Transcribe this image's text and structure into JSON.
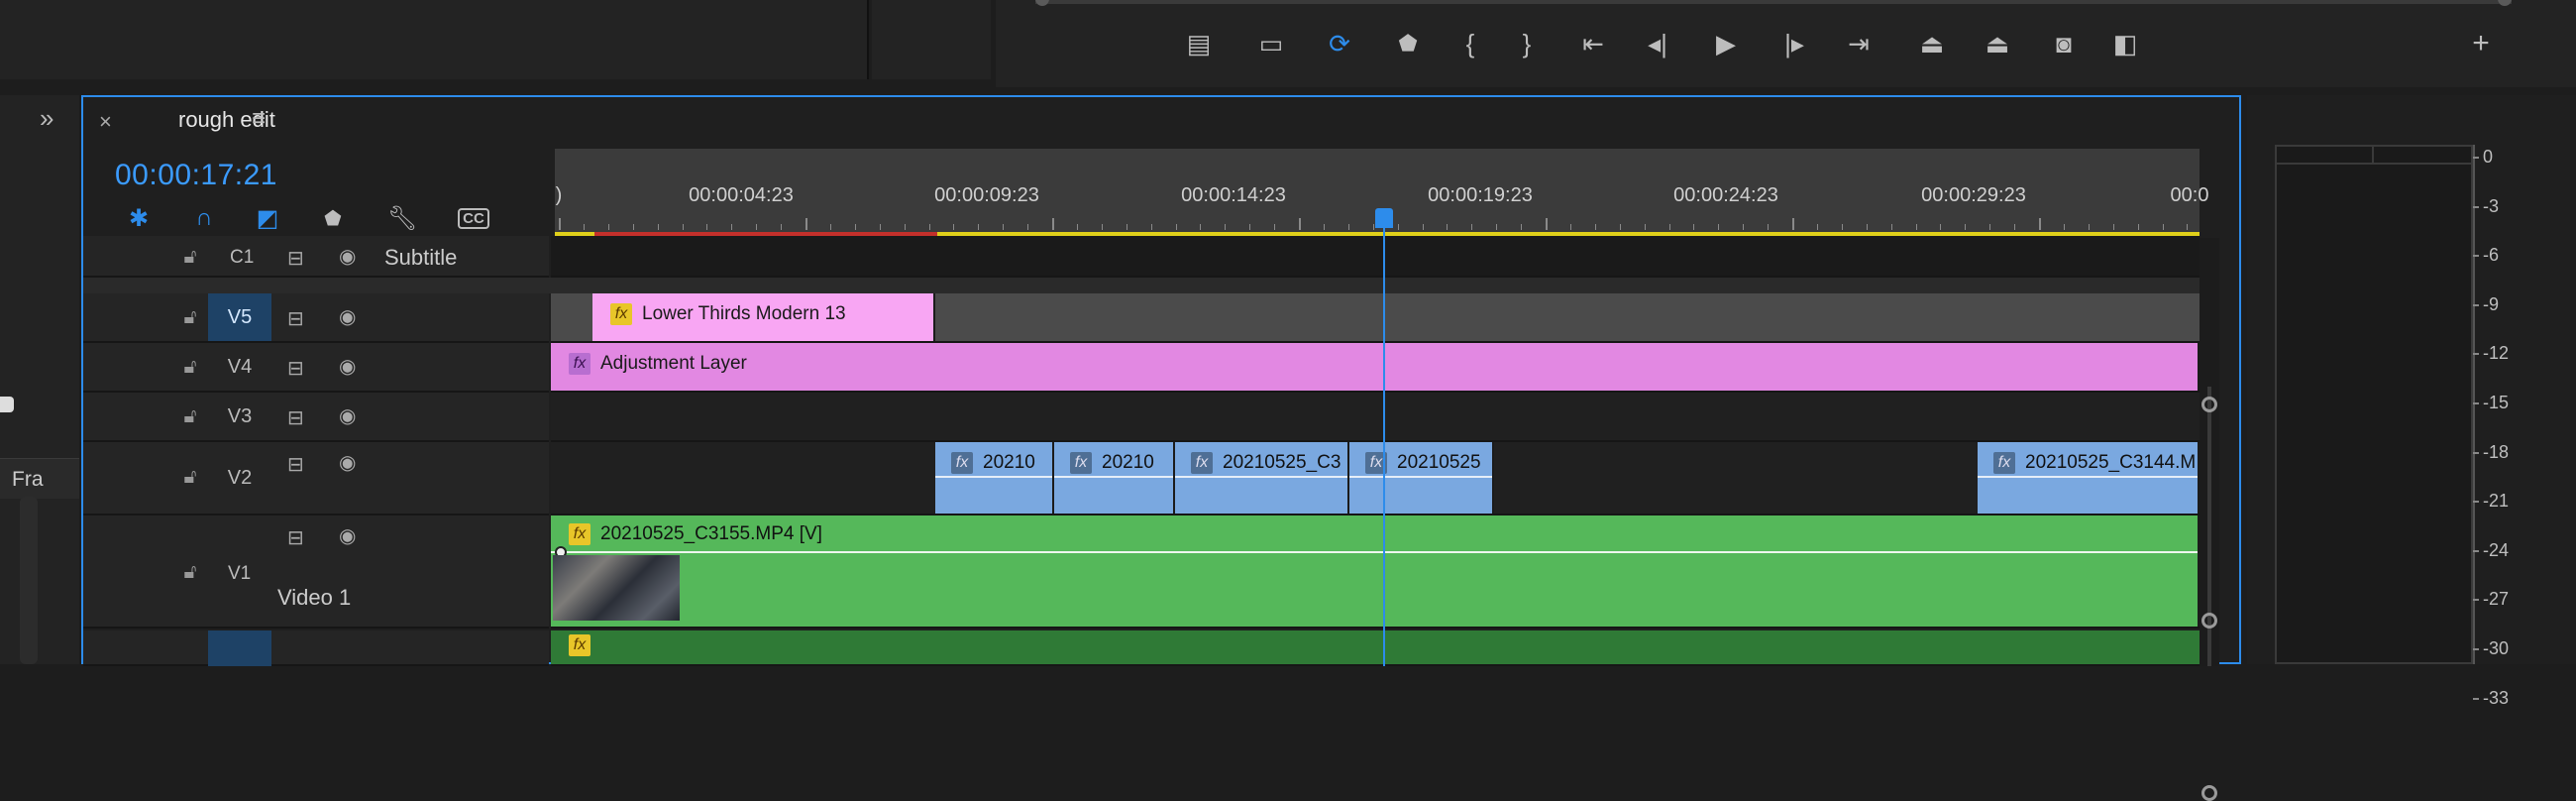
{
  "window": {
    "tab_title": "rough edit",
    "timecode": "00:00:17:21"
  },
  "program_controls": [
    {
      "name": "button-editor-icon"
    },
    {
      "name": "safe-margins-icon"
    },
    {
      "name": "loop-icon",
      "active": true
    },
    {
      "name": "marker-icon"
    },
    {
      "name": "mark-in-icon"
    },
    {
      "name": "mark-out-icon"
    },
    {
      "name": "go-to-in-icon"
    },
    {
      "name": "step-back-icon"
    },
    {
      "name": "play-icon"
    },
    {
      "name": "step-forward-icon"
    },
    {
      "name": "go-to-out-icon"
    },
    {
      "name": "lift-icon"
    },
    {
      "name": "extract-icon"
    },
    {
      "name": "export-frame-icon"
    },
    {
      "name": "compare-view-icon"
    },
    {
      "name": "add-button-icon"
    }
  ],
  "left_panel": {
    "expand_icon": "»",
    "partial_label": "Fra"
  },
  "ruler": {
    "labels": [
      "00:00:04:23",
      "00:00:09:23",
      "00:00:14:23",
      "00:00:19:23",
      "00:00:24:23",
      "00:00:29:23",
      "00:0"
    ],
    "edge_label": ")"
  },
  "tracks": {
    "c1": {
      "name": "C1",
      "label": "Subtitle"
    },
    "v5": {
      "name": "V5",
      "clip": "Lower Thirds Modern 13"
    },
    "v4": {
      "name": "V4",
      "clip": "Adjustment Layer"
    },
    "v3": {
      "name": "V3"
    },
    "v2": {
      "name": "V2",
      "clips": [
        "20210",
        "20210",
        "20210525_C3",
        "20210525",
        "20210525_C3144.M"
      ]
    },
    "v1": {
      "name": "V1",
      "label": "Video 1",
      "clip": "20210525_C3155.MP4 [V]"
    }
  },
  "fx_label": "fx",
  "meter": {
    "db_labels": [
      "0",
      "-3",
      "-6",
      "-9",
      "-12",
      "-15",
      "-18",
      "-21",
      "-24",
      "-27",
      "-30",
      "-33"
    ]
  },
  "colors": {
    "accent": "#2d8ceb",
    "pink": "#f2a6f0",
    "magenta": "#e28ae2",
    "blue_clip": "#7aa8e0",
    "green_clip": "#55b85a"
  }
}
